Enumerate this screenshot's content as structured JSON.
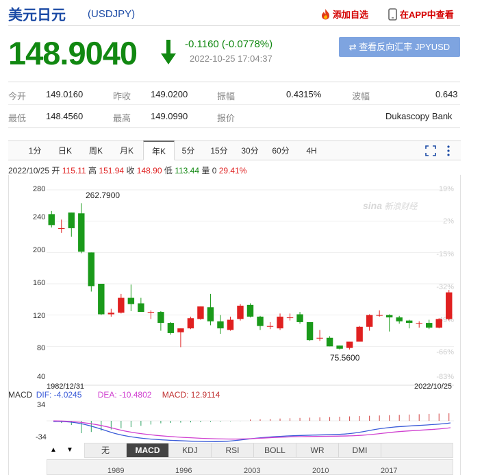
{
  "header": {
    "title": "美元日元",
    "code": "(USDJPY)",
    "add_watch": "添加自选",
    "app_view": "在APP中查看"
  },
  "quote": {
    "price": "148.9040",
    "change": "-0.1160 (-0.0778%)",
    "time": "2022-10-25 17:04:37",
    "reverse_button": "查看反向汇率 JPYUSD"
  },
  "stats": {
    "open_label": "今开",
    "open": "149.0160",
    "prev_label": "昨收",
    "prev": "149.0200",
    "amp_label": "振幅",
    "amp": "0.4315%",
    "wave_label": "波幅",
    "wave": "0.643",
    "low_label": "最低",
    "low": "148.4560",
    "high_label": "最高",
    "high": "149.0990",
    "source_label": "报价",
    "source": "Dukascopy Bank"
  },
  "tabs": [
    "1分",
    "日K",
    "周K",
    "月K",
    "年K",
    "5分",
    "15分",
    "30分",
    "60分",
    "4H"
  ],
  "active_tab": "年K",
  "info": {
    "date": "2022/10/25",
    "open_l": "开",
    "open": "115.11",
    "high_l": "高",
    "high": "151.94",
    "close_l": "收",
    "close": "148.90",
    "low_l": "低",
    "low": "113.44",
    "vol_l": "量",
    "vol": "0",
    "pct": "29.41%"
  },
  "watermark": "新浪财经",
  "chart_data": {
    "type": "candlestick",
    "y_ticks": [
      "280",
      "240",
      "200",
      "160",
      "120",
      "80",
      "40"
    ],
    "y_pct_ticks": [
      "19%",
      "2%",
      "-15%",
      "-32%",
      "-49%",
      "-66%",
      "-83%"
    ],
    "ylim": [
      40,
      280
    ],
    "max_label": "262.7900",
    "min_label": "75.5600",
    "start_date": "1982/12/31",
    "end_date": "2022/10/25",
    "up_color": "#e02020",
    "down_color": "#1a9a1a",
    "candles": [
      {
        "o": 249,
        "h": 253,
        "l": 232,
        "c": 235
      },
      {
        "o": 230,
        "h": 242,
        "l": 225,
        "c": 231
      },
      {
        "o": 251,
        "h": 251,
        "l": 220,
        "c": 231
      },
      {
        "o": 250,
        "h": 263,
        "l": 199,
        "c": 201
      },
      {
        "o": 200,
        "h": 200,
        "l": 150,
        "c": 157
      },
      {
        "o": 160,
        "h": 160,
        "l": 120,
        "c": 121
      },
      {
        "o": 121,
        "h": 128,
        "l": 118,
        "c": 123
      },
      {
        "o": 123,
        "h": 147,
        "l": 122,
        "c": 142
      },
      {
        "o": 142,
        "h": 159,
        "l": 125,
        "c": 134
      },
      {
        "o": 135,
        "h": 142,
        "l": 125,
        "c": 124
      },
      {
        "o": 123,
        "h": 126,
        "l": 115,
        "c": 124
      },
      {
        "o": 124,
        "h": 125,
        "l": 100,
        "c": 110
      },
      {
        "o": 110,
        "h": 111,
        "l": 95,
        "c": 97
      },
      {
        "o": 98,
        "h": 103,
        "l": 79,
        "c": 103
      },
      {
        "o": 103,
        "h": 118,
        "l": 102,
        "c": 116
      },
      {
        "o": 115,
        "h": 131,
        "l": 114,
        "c": 131
      },
      {
        "o": 130,
        "h": 147,
        "l": 107,
        "c": 112
      },
      {
        "o": 112,
        "h": 120,
        "l": 96,
        "c": 103
      },
      {
        "o": 101,
        "h": 118,
        "l": 100,
        "c": 114
      },
      {
        "o": 115,
        "h": 134,
        "l": 113,
        "c": 132
      },
      {
        "o": 133,
        "h": 135,
        "l": 117,
        "c": 118
      },
      {
        "o": 118,
        "h": 119,
        "l": 101,
        "c": 106
      },
      {
        "o": 105,
        "h": 111,
        "l": 102,
        "c": 106
      },
      {
        "o": 103,
        "h": 122,
        "l": 101,
        "c": 118
      },
      {
        "o": 117,
        "h": 122,
        "l": 113,
        "c": 117
      },
      {
        "o": 121,
        "h": 124,
        "l": 109,
        "c": 111
      },
      {
        "o": 111,
        "h": 111,
        "l": 87,
        "c": 88
      },
      {
        "o": 90,
        "h": 101,
        "l": 87,
        "c": 91
      },
      {
        "o": 91,
        "h": 93,
        "l": 80,
        "c": 80
      },
      {
        "o": 81,
        "h": 81,
        "l": 76,
        "c": 77
      },
      {
        "o": 78,
        "h": 86,
        "l": 76,
        "c": 86
      },
      {
        "o": 86,
        "h": 106,
        "l": 86,
        "c": 105
      },
      {
        "o": 105,
        "h": 121,
        "l": 100,
        "c": 120
      },
      {
        "o": 120,
        "h": 126,
        "l": 118,
        "c": 120
      },
      {
        "o": 120,
        "h": 121,
        "l": 99,
        "c": 117
      },
      {
        "o": 117,
        "h": 119,
        "l": 109,
        "c": 112
      },
      {
        "o": 113,
        "h": 114,
        "l": 103,
        "c": 110
      },
      {
        "o": 110,
        "h": 112,
        "l": 104,
        "c": 110
      },
      {
        "o": 110,
        "h": 114,
        "l": 102,
        "c": 104
      },
      {
        "o": 104,
        "h": 116,
        "l": 103,
        "c": 115
      },
      {
        "o": 115,
        "h": 152,
        "l": 113,
        "c": 149
      }
    ]
  },
  "macd": {
    "label": "MACD",
    "dif": "DIF: -4.0245",
    "dea": "DEA: -10.4802",
    "macd": "MACD: 12.9114",
    "top": "34",
    "bottom": "-34"
  },
  "indicators": [
    "无",
    "MACD",
    "KDJ",
    "RSI",
    "BOLL",
    "WR",
    "DMI"
  ],
  "active_indicator": "MACD",
  "nav_years": [
    "1989",
    "1996",
    "2003",
    "2010",
    "2017"
  ]
}
